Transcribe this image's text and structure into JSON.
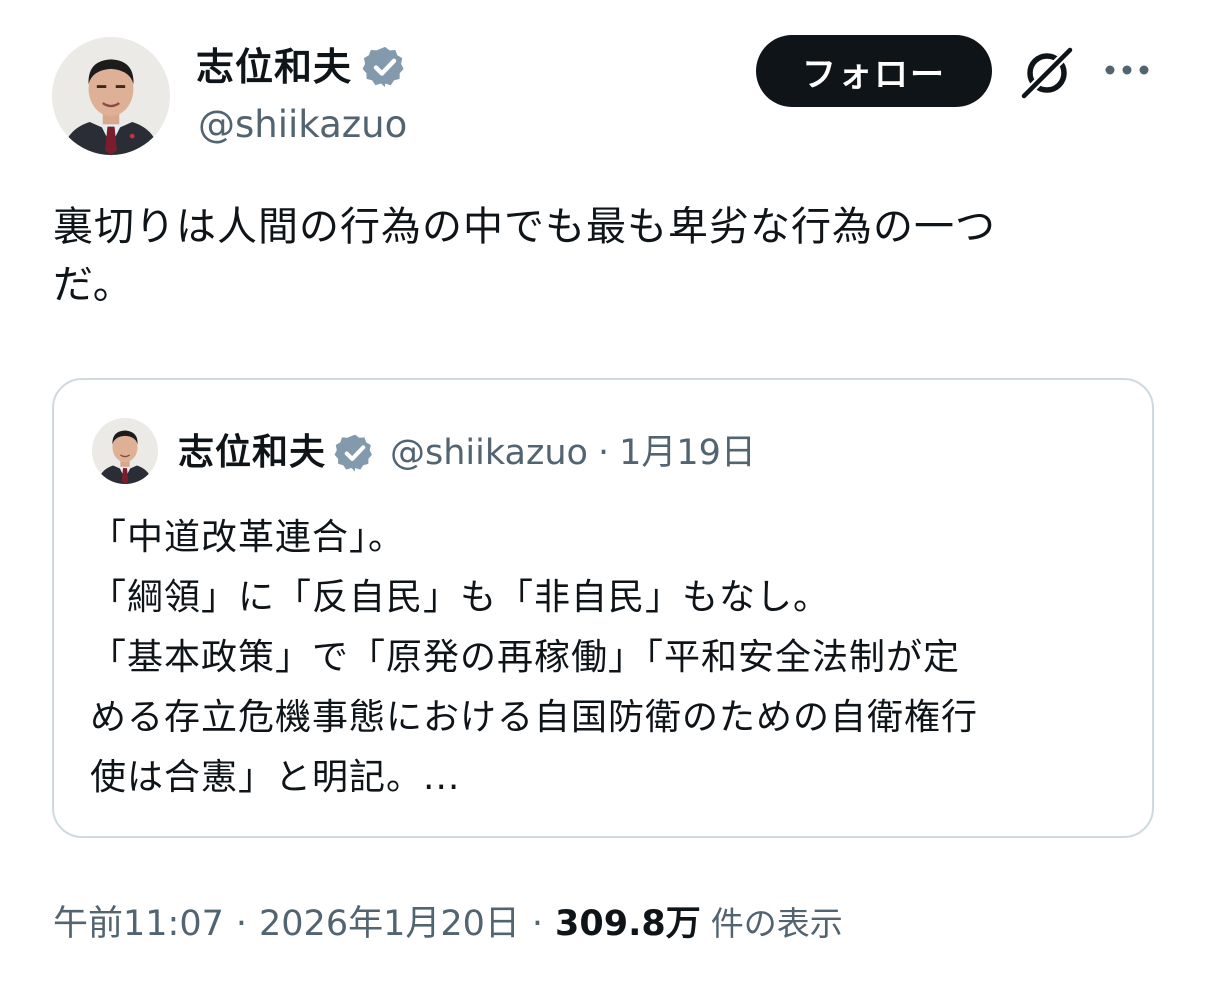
{
  "author": {
    "display_name": "志位和夫",
    "handle": "@shiikazuo",
    "verified": true,
    "verified_badge_color": "#829aab"
  },
  "actions": {
    "follow_label": "フォロー",
    "grok_icon": "grok-icon",
    "more_icon": "more-icon"
  },
  "tweet": {
    "text_lines": [
      "裏切りは人間の行為の中でも最も卑劣な行為の一つ",
      "だ。"
    ]
  },
  "quoted_tweet": {
    "display_name": "志位和夫",
    "handle": "@shiikazuo",
    "separator": "·",
    "date": "1月19日",
    "lines": [
      "「中道改革連合」。",
      "「綱領」に「反自民」も「非自民」もなし。",
      "「基本政策」で「原発の再稼働」「平和安全法制が定",
      "める存立危機事態における自国防衛のための自衛権行",
      "使は合憲」と明記。..."
    ]
  },
  "meta": {
    "time": "午前11:07",
    "separator": "·",
    "date": "2026年1月20日",
    "views_count": "309.8万",
    "views_label": "件の表示"
  },
  "colors": {
    "text": "#0f1419",
    "secondary": "#536471",
    "border": "#cfd9de",
    "button_bg": "#0f1419",
    "button_text": "#ffffff"
  }
}
